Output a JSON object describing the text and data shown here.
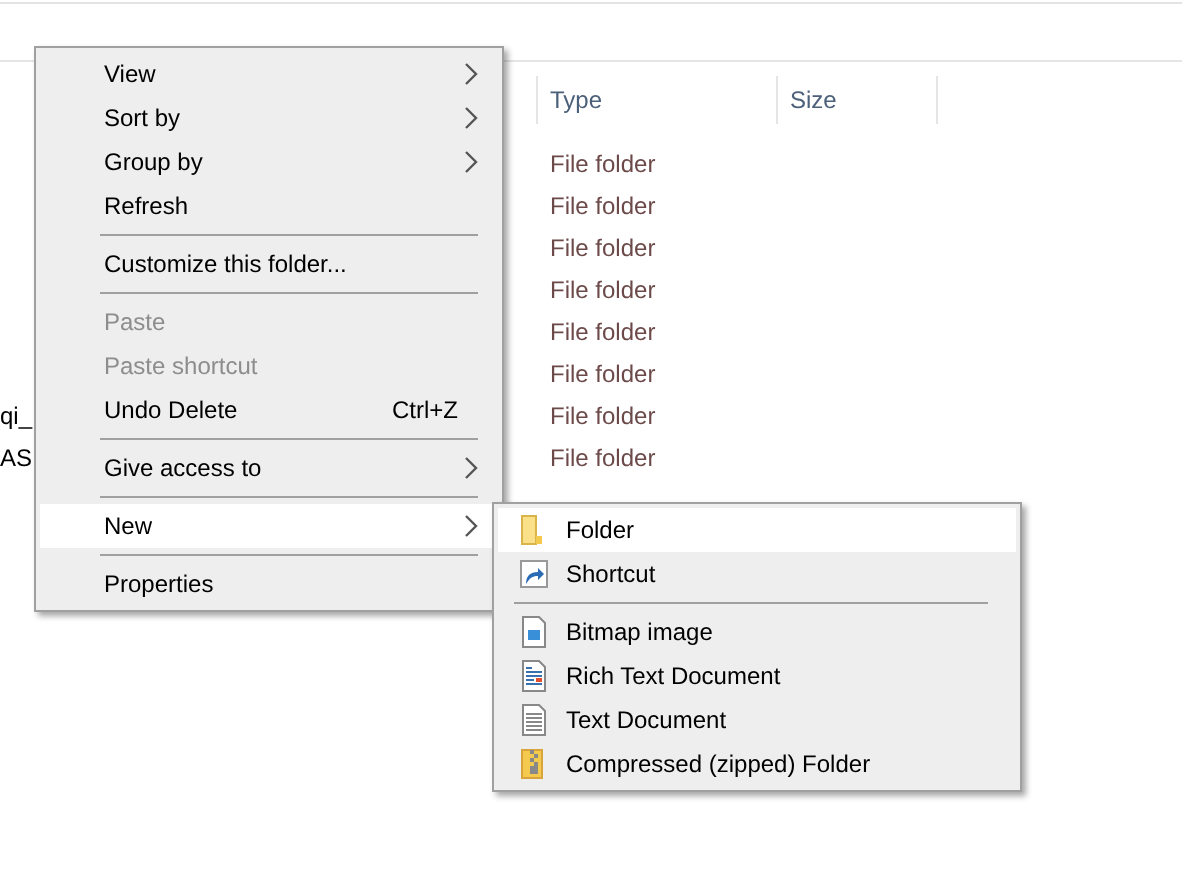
{
  "file_list": {
    "columns": [
      "Type",
      "Size"
    ],
    "rows": [
      {
        "type": "File folder"
      },
      {
        "type": "File folder"
      },
      {
        "type": "File folder"
      },
      {
        "type": "File folder"
      },
      {
        "type": "File folder"
      },
      {
        "type": "File folder"
      },
      {
        "name": "qi_",
        "type": "File folder"
      },
      {
        "name": "AS",
        "type": "File folder"
      }
    ]
  },
  "context_menu": {
    "items": [
      {
        "kind": "item",
        "label": "View",
        "submenu": true,
        "disabled": false,
        "selected": false
      },
      {
        "kind": "item",
        "label": "Sort by",
        "submenu": true,
        "disabled": false,
        "selected": false
      },
      {
        "kind": "item",
        "label": "Group by",
        "submenu": true,
        "disabled": false,
        "selected": false
      },
      {
        "kind": "item",
        "label": "Refresh",
        "submenu": false,
        "disabled": false,
        "selected": false
      },
      {
        "kind": "separator"
      },
      {
        "kind": "item",
        "label": "Customize this folder...",
        "submenu": false,
        "disabled": false,
        "selected": false
      },
      {
        "kind": "separator"
      },
      {
        "kind": "item",
        "label": "Paste",
        "submenu": false,
        "disabled": true,
        "selected": false
      },
      {
        "kind": "item",
        "label": "Paste shortcut",
        "submenu": false,
        "disabled": true,
        "selected": false
      },
      {
        "kind": "item",
        "label": "Undo Delete",
        "shortcut": "Ctrl+Z",
        "submenu": false,
        "disabled": false,
        "selected": false
      },
      {
        "kind": "separator"
      },
      {
        "kind": "item",
        "label": "Give access to",
        "submenu": true,
        "disabled": false,
        "selected": false
      },
      {
        "kind": "separator"
      },
      {
        "kind": "item",
        "label": "New",
        "submenu": true,
        "disabled": false,
        "selected": true
      },
      {
        "kind": "separator"
      },
      {
        "kind": "item",
        "label": "Properties",
        "submenu": false,
        "disabled": false,
        "selected": false
      }
    ]
  },
  "new_submenu": {
    "items": [
      {
        "kind": "folder",
        "label": "Folder",
        "selected": true
      },
      {
        "kind": "shortcut",
        "label": "Shortcut",
        "selected": false
      },
      {
        "kind": "separator"
      },
      {
        "kind": "bitmap",
        "label": "Bitmap image",
        "selected": false
      },
      {
        "kind": "rich-text",
        "label": "Rich Text Document",
        "selected": false
      },
      {
        "kind": "text",
        "label": "Text Document",
        "selected": false
      },
      {
        "kind": "zip",
        "label": "Compressed (zipped) Folder",
        "selected": false
      }
    ]
  }
}
